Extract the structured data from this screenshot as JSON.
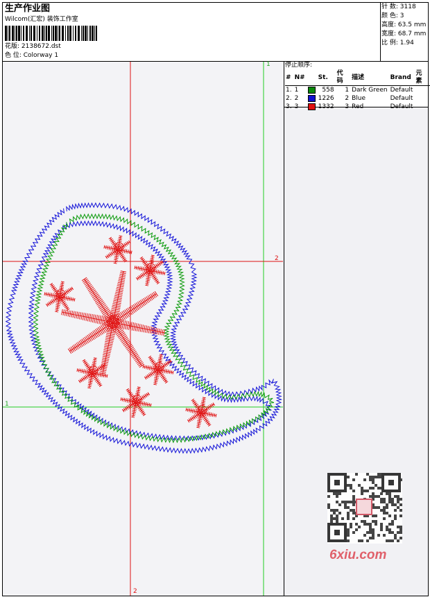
{
  "header": {
    "title": "生产作业图",
    "company": "Wilcom(汇宏) 装饰工作室",
    "design_label": "花版: 2138672.dst",
    "colorway_label": "色 位:  Colorway 1"
  },
  "stats": [
    {
      "label": "针 数:",
      "value": "3118"
    },
    {
      "label": "颜 色:",
      "value": "3"
    },
    {
      "label": "高度:",
      "value": "63.5 mm"
    },
    {
      "label": "宽度:",
      "value": "68.7 mm"
    },
    {
      "label": "比 例:",
      "value": "1.94"
    }
  ],
  "stops": {
    "title": "停止顺序:",
    "headers": [
      "#",
      "N#",
      "St.",
      "代码",
      "描述",
      "Brand",
      "元素"
    ],
    "rows": [
      {
        "idx": "1.",
        "n": "1",
        "color": "#0a8a0a",
        "st": "558",
        "code": "1",
        "desc": "Dark Green",
        "brand": "Default"
      },
      {
        "idx": "2.",
        "n": "2",
        "color": "#1010d0",
        "st": "1226",
        "code": "2",
        "desc": "Blue",
        "brand": "Default"
      },
      {
        "idx": "3.",
        "n": "3",
        "color": "#e01010",
        "st": "1332",
        "code": "3",
        "desc": "Red",
        "brand": "Default"
      }
    ]
  },
  "guides": {
    "v1_label": "1",
    "h2_label": "2",
    "h1_label": "1",
    "v2_label": "2"
  },
  "watermark": "6xiu.com",
  "colors": {
    "green": "#0a9a0a",
    "blue": "#1414d8",
    "red": "#e01414",
    "guide_green": "#22cc22",
    "guide_red": "#dd1111"
  }
}
